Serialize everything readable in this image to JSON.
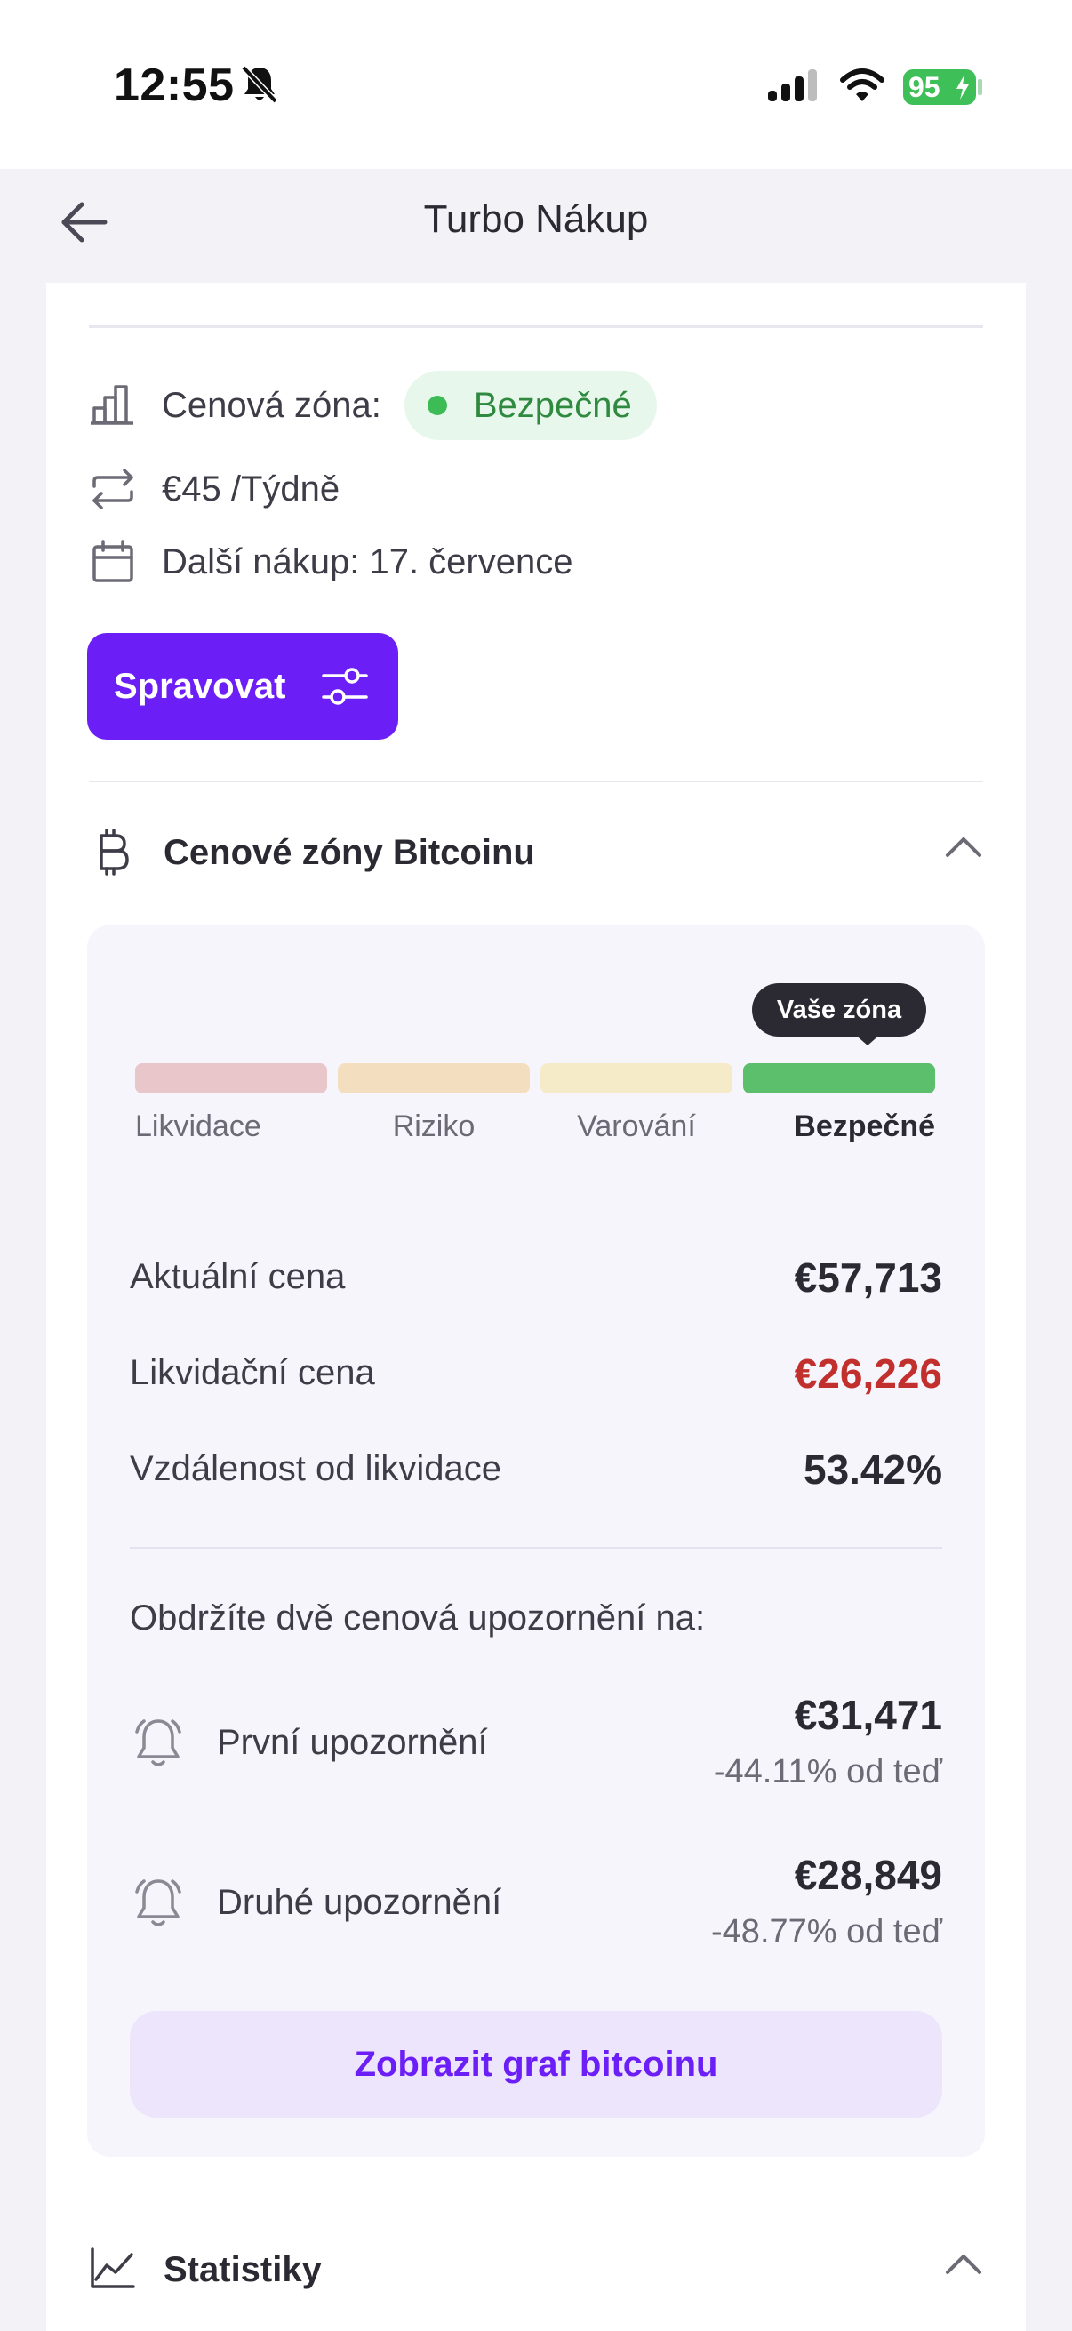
{
  "status_bar": {
    "time": "12:55",
    "battery": "95",
    "icons": [
      "bell-off-icon",
      "signal-icon",
      "wifi-icon",
      "battery-charging-icon"
    ]
  },
  "header": {
    "title": "Turbo Nákup",
    "back_icon": "arrow-left-icon"
  },
  "plan": {
    "price_zone_label": "Cenová zóna:",
    "price_zone_value": "Bezpečné",
    "amount": "€45 /Týdně",
    "next_purchase": "Další nákup: 17. července",
    "manage_button": "Spravovat"
  },
  "zones_section": {
    "title": "Cenové zóny Bitcoinu",
    "tooltip": "Vaše zóna",
    "zones": [
      {
        "label": "Likvidace",
        "color": "#e8c6ca"
      },
      {
        "label": "Riziko",
        "color": "#f3dfbf"
      },
      {
        "label": "Varování",
        "color": "#f6ebc8"
      },
      {
        "label": "Bezpečné",
        "color": "#5cbf6b"
      }
    ],
    "current_price_label": "Aktuální cena",
    "current_price_value": "€57,713",
    "liquidation_price_label": "Likvidační cena",
    "liquidation_price_value": "€26,226",
    "distance_label": "Vzdálenost od likvidace",
    "distance_value": "53.42%",
    "alerts_intro": "Obdržíte dvě cenová upozornění na:",
    "alerts": [
      {
        "label": "První upozornění",
        "price": "€31,471",
        "change": "-44.11% od teď"
      },
      {
        "label": "Druhé upozornění",
        "price": "€28,849",
        "change": "-48.77% od teď"
      }
    ],
    "chart_button": "Zobrazit graf bitcoinu"
  },
  "stats_section": {
    "title": "Statistiky"
  },
  "colors": {
    "accent": "#6b1ef5",
    "safe_green": "#3dbb55",
    "danger_red": "#c2302e"
  }
}
